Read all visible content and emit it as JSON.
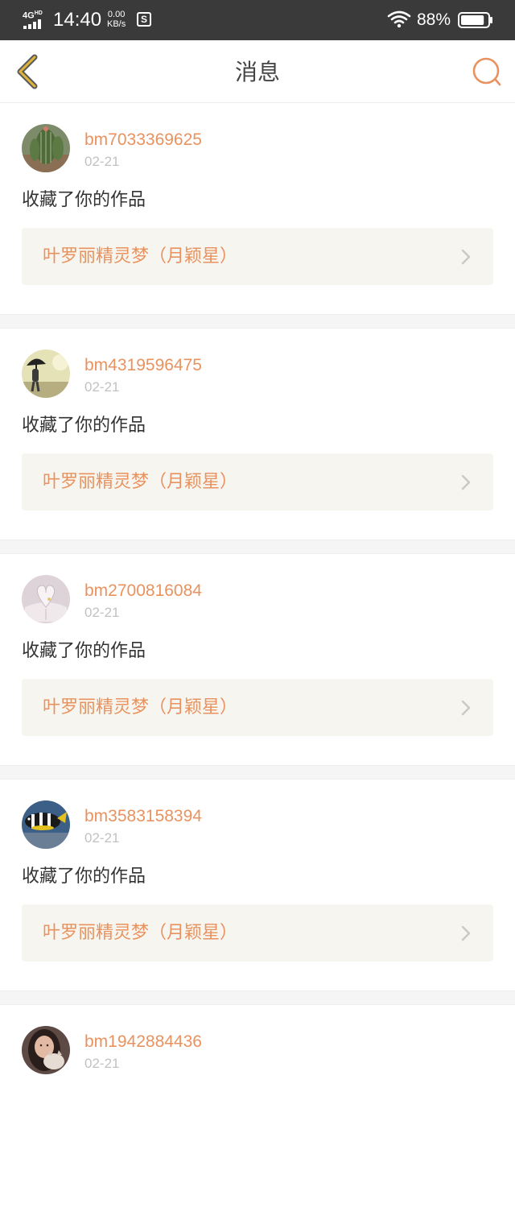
{
  "status_bar": {
    "network": "4G",
    "network_sub": "HD",
    "time": "14:40",
    "speed_value": "0.00",
    "speed_unit": "KB/s",
    "app_icon": "S",
    "battery": "88%",
    "battery_level": 0.88
  },
  "nav": {
    "title": "消息",
    "back_icon": "chevron-left-icon",
    "chat_icon": "chat-bubble-icon"
  },
  "colors": {
    "accent": "#e8935f",
    "back_chevron": "#e0b43a",
    "card_bg": "#f7f5ef"
  },
  "messages": [
    {
      "username": "bm7033369625",
      "date": "02-21",
      "action": "收藏了你的作品",
      "work_title": "叶罗丽精灵梦（月颖星）",
      "avatar": "cactus-avatar"
    },
    {
      "username": "bm4319596475",
      "date": "02-21",
      "action": "收藏了你的作品",
      "work_title": "叶罗丽精灵梦（月颖星）",
      "avatar": "umbrella-figure-avatar"
    },
    {
      "username": "bm2700816084",
      "date": "02-21",
      "action": "收藏了你的作品",
      "work_title": "叶罗丽精灵梦（月颖星）",
      "avatar": "book-heart-avatar"
    },
    {
      "username": "bm3583158394",
      "date": "02-21",
      "action": "收藏了你的作品",
      "work_title": "叶罗丽精灵梦（月颖星）",
      "avatar": "clownfish-avatar"
    },
    {
      "username": "bm1942884436",
      "date": "02-21",
      "action": "",
      "work_title": "",
      "avatar": "girl-with-cat-avatar"
    }
  ]
}
